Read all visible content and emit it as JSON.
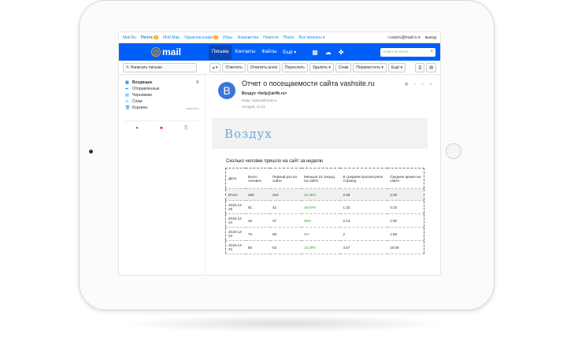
{
  "colors": {
    "accent": "#005ff9",
    "badge": "#ff9e00",
    "link": "#168de2",
    "positive": "#2da12d"
  },
  "topbar": {
    "links": [
      "Mail.Ru",
      "Почта",
      "Мой Мир",
      "Одноклассники",
      "Игры",
      "Знакомства",
      "Новости",
      "Поиск",
      "Все проекты ▾"
    ],
    "mail_badge": "8",
    "ok_badge": "2",
    "account": "• ivanov@mail.ru ▾",
    "logout": "выход"
  },
  "header": {
    "logo": "mail",
    "nav": [
      "Письма",
      "Контакты",
      "Файлы",
      "Ещё ▾"
    ],
    "search_placeholder": "Поиск по почте",
    "icons": [
      "calendar-icon",
      "cloud-icon",
      "games-icon"
    ]
  },
  "toolbar": {
    "compose": "✎ Написать письмо",
    "nav_arrows": "▴ ▾",
    "actions": [
      "Ответить",
      "Ответить всем",
      "Переслать",
      "Удалить ▾",
      "Спам",
      "Переместить ▾",
      "Ещё ▾"
    ]
  },
  "folders": [
    {
      "icon": "▣",
      "label": "Входящие",
      "count": "9",
      "active": true
    },
    {
      "icon": "➦",
      "label": "Отправленные",
      "count": ""
    },
    {
      "icon": "▤",
      "label": "Черновики",
      "count": ""
    },
    {
      "icon": "⚠",
      "label": "Спам",
      "count": ""
    },
    {
      "icon": "🗑",
      "label": "Корзина",
      "count": "",
      "clean": "очистить"
    }
  ],
  "mail": {
    "avatar": "B",
    "subject": "Отчет о посещаемости сайта vashsite.ru",
    "from": "Воздух <help@airfb.ru>",
    "to": "Кому: ivanov@mail.ru",
    "date": "сегодня, 11:21",
    "banner": "Воздух",
    "report_title": "Сколько человек пришло на сайт за неделю",
    "table": {
      "headers": [
        "Дата",
        "Всего человек",
        "Первый раз на сайте",
        "Меньше 15 секунд на сайте",
        "В среднем просмотрели страниц",
        "Среднее время на сайте"
      ],
      "rows": [
        [
          "Итого",
          "260",
          "210",
          "15.38%",
          "2.58",
          "3:29"
        ],
        [
          "2018-12-25",
          "61",
          "42",
          "16.67%",
          "1.33",
          "0:15"
        ],
        [
          "2018-12-24",
          "49",
          "37",
          "25%",
          "2.13",
          "1:00"
        ],
        [
          "2018-12-23",
          "70",
          "68",
          "0%",
          "2",
          "1:58"
        ],
        [
          "2018-12-22",
          "80",
          "63",
          "14.29%",
          "4.57",
          "10:09"
        ]
      ]
    }
  }
}
